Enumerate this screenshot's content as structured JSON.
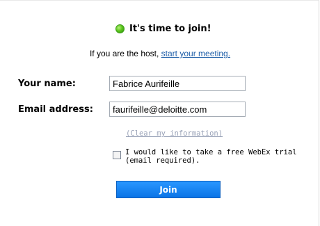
{
  "status": {
    "icon": "green-status-dot-icon",
    "color": "#5cc61d",
    "text": "It's time to join!"
  },
  "host": {
    "prefix": "If you are the host, ",
    "link_text": "start your meeting."
  },
  "form": {
    "name_label": "Your name:",
    "name_value": "Fabrice Aurifeille",
    "email_label": "Email address:",
    "email_value": "faurifeille@deloitte.com",
    "clear_link": "(Clear my information)",
    "trial_label": "I would like to take a free WebEx trial (email required).",
    "trial_checked": false
  },
  "join_button": {
    "label": "Join",
    "color": "#1585f2"
  }
}
